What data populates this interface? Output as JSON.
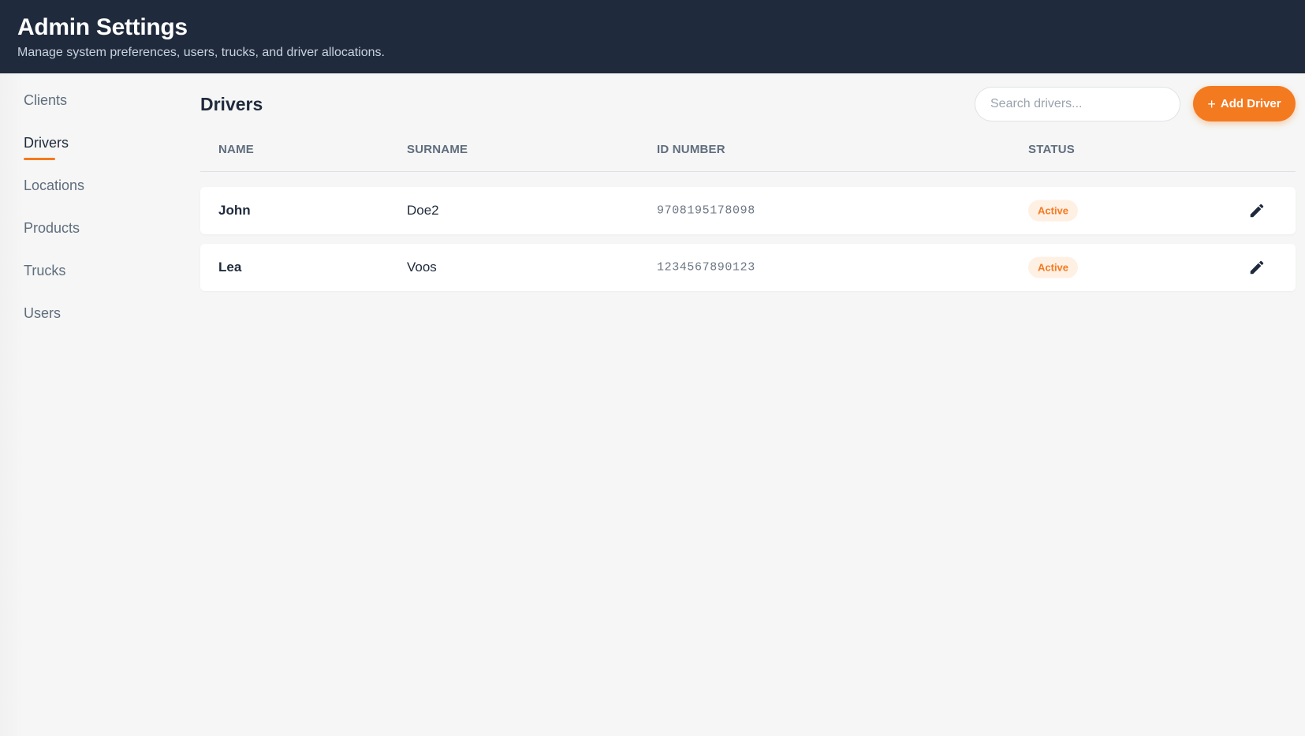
{
  "header": {
    "title": "Admin Settings",
    "subtitle": "Manage system preferences, users, trucks, and driver allocations."
  },
  "sidebar": {
    "items": [
      {
        "label": "Clients",
        "active": false
      },
      {
        "label": "Drivers",
        "active": true
      },
      {
        "label": "Locations",
        "active": false
      },
      {
        "label": "Products",
        "active": false
      },
      {
        "label": "Trucks",
        "active": false
      },
      {
        "label": "Users",
        "active": false
      }
    ]
  },
  "main": {
    "title": "Drivers",
    "search": {
      "placeholder": "Search drivers...",
      "value": ""
    },
    "add_button": {
      "icon": "plus-icon",
      "label": "Add Driver"
    },
    "table": {
      "columns": [
        "NAME",
        "SURNAME",
        "ID NUMBER",
        "STATUS"
      ],
      "rows": [
        {
          "name": "John",
          "surname": "Doe2",
          "id_number": "9708195178098",
          "status": "Active"
        },
        {
          "name": "Lea",
          "surname": "Voos",
          "id_number": "1234567890123",
          "status": "Active"
        }
      ]
    }
  },
  "colors": {
    "header_bg": "#1f2a3c",
    "accent": "#f47a20",
    "page_bg": "#f5f6f5",
    "muted_text": "#5f6d7e"
  },
  "icons": {
    "edit": "pencil-icon",
    "add": "plus-icon"
  }
}
